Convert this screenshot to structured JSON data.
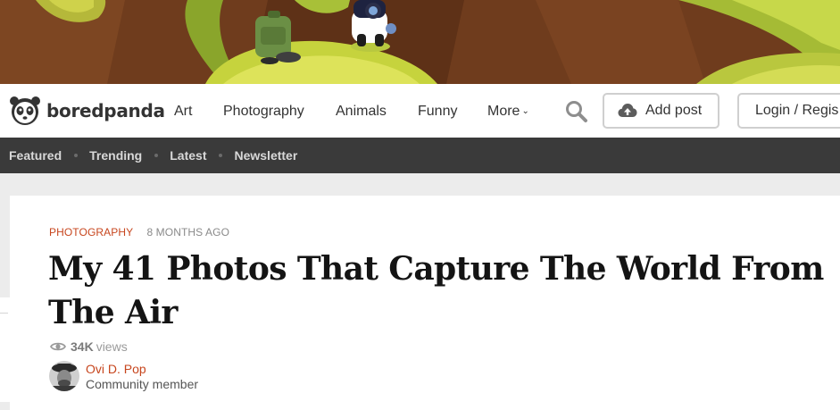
{
  "banner": {
    "description_icon": "illustrated-banner"
  },
  "header": {
    "logo_text": "boredpanda",
    "nav": [
      {
        "label": "Art"
      },
      {
        "label": "Photography"
      },
      {
        "label": "Animals"
      },
      {
        "label": "Funny"
      },
      {
        "label": "More"
      }
    ],
    "search_icon": "search-icon",
    "add_post_label": "Add post",
    "login_label": "Login / Regis"
  },
  "subnav": {
    "items": [
      {
        "label": "Featured"
      },
      {
        "label": "Trending"
      },
      {
        "label": "Latest"
      },
      {
        "label": "Newsletter"
      }
    ]
  },
  "article": {
    "category": "Photography",
    "posted": "8 months ago",
    "title": "My 41 Photos That Capture The World From The Air",
    "views_count": "34K",
    "views_unit": "views",
    "author_name": "Ovi D. Pop",
    "author_role": "Community member"
  },
  "colors": {
    "accent": "#c7461e",
    "subnav_bg": "#3a3a3a",
    "page_bg": "#ececec"
  }
}
